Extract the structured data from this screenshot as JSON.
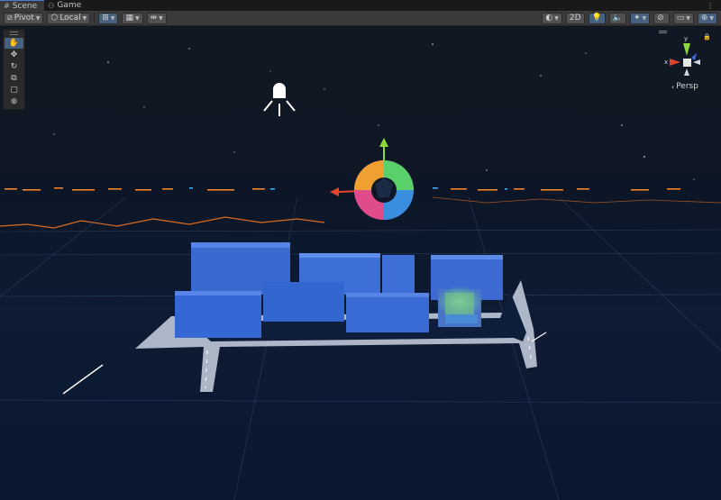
{
  "tabs": [
    {
      "label": "Scene",
      "icon": "grid-icon"
    },
    {
      "label": "Game",
      "icon": "gamepad-icon"
    }
  ],
  "toolbar": {
    "pivot_label": "Pivot",
    "local_label": "Local",
    "two_d_label": "2D"
  },
  "gizmo": {
    "x_label": "x",
    "y_label": "y",
    "projection_label": "Persp"
  },
  "colors": {
    "accent": "#46607f",
    "building": "#3f6fd6",
    "skyline_glow": "#ff8a2a",
    "axis_x": "#e2452b",
    "axis_y": "#8cd93a",
    "axis_z": "#3a66e0"
  }
}
